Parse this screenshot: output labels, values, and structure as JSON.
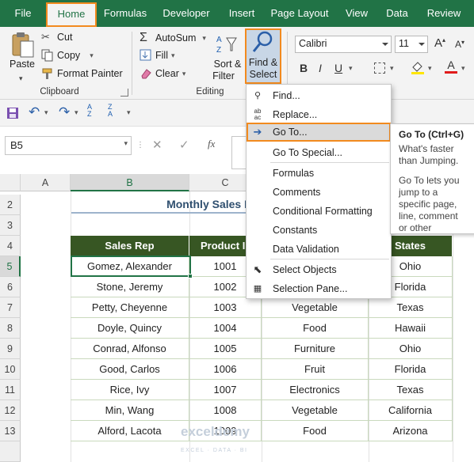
{
  "tabs": [
    "File",
    "Home",
    "Formulas",
    "Developer",
    "Insert",
    "Page Layout",
    "View",
    "Data",
    "Review"
  ],
  "active_tab": "Home",
  "clipboard": {
    "paste": "Paste",
    "cut": "Cut",
    "copy": "Copy",
    "format_painter": "Format Painter",
    "group": "Clipboard"
  },
  "editing": {
    "autosum": "AutoSum",
    "fill": "Fill",
    "clear": "Clear",
    "sort_filter_1": "Sort &",
    "sort_filter_2": "Filter",
    "find_select_1": "Find &",
    "find_select_2": "Select",
    "group": "Editing"
  },
  "font": {
    "name": "Calibri",
    "size": "11"
  },
  "name_box": "B5",
  "columns": [
    "A",
    "B",
    "C"
  ],
  "rows": [
    "2",
    "3",
    "4",
    "5",
    "6",
    "7",
    "8",
    "9",
    "10",
    "11",
    "12",
    "13"
  ],
  "sheet_title": "Monthly Sales Re",
  "table_headers": {
    "rep": "Sales Rep",
    "product": "Product I",
    "states": "States"
  },
  "table_rows": [
    {
      "rep": "Gomez, Alexander",
      "id": "1001",
      "cat": "",
      "state": "Ohio"
    },
    {
      "rep": "Stone, Jeremy",
      "id": "1002",
      "cat": "",
      "state": "Florida"
    },
    {
      "rep": "Petty, Cheyenne",
      "id": "1003",
      "cat": "Vegetable",
      "state": "Texas"
    },
    {
      "rep": "Doyle, Quincy",
      "id": "1004",
      "cat": "Food",
      "state": "Hawaii"
    },
    {
      "rep": "Conrad, Alfonso",
      "id": "1005",
      "cat": "Furniture",
      "state": "Ohio"
    },
    {
      "rep": "Good, Carlos",
      "id": "1006",
      "cat": "Fruit",
      "state": "Florida"
    },
    {
      "rep": "Rice, Ivy",
      "id": "1007",
      "cat": "Electronics",
      "state": "Texas"
    },
    {
      "rep": "Min, Wang",
      "id": "1008",
      "cat": "Vegetable",
      "state": "California"
    },
    {
      "rep": "Alford, Lacota",
      "id": "1009",
      "cat": "Food",
      "state": "Arizona"
    }
  ],
  "menu": {
    "find": "Find...",
    "replace": "Replace...",
    "goto": "Go To...",
    "goto_special": "Go To Special...",
    "formulas": "Formulas",
    "comments": "Comments",
    "conditional": "Conditional Formatting",
    "constants": "Constants",
    "data_validation": "Data Validation",
    "select_objects": "Select Objects",
    "selection_pane": "Selection Pane..."
  },
  "tooltip": {
    "title": "Go To (Ctrl+G)",
    "line1": "What's faster than Jumping.",
    "line2": "Go To lets you jump to a specific page, line, comment or other document."
  },
  "watermark": {
    "main": "exceldemy",
    "sub": "EXCEL · DATA · BI"
  },
  "colors": {
    "excel_green": "#217346",
    "header_green": "#375623",
    "highlight_orange": "#f28a1e"
  }
}
